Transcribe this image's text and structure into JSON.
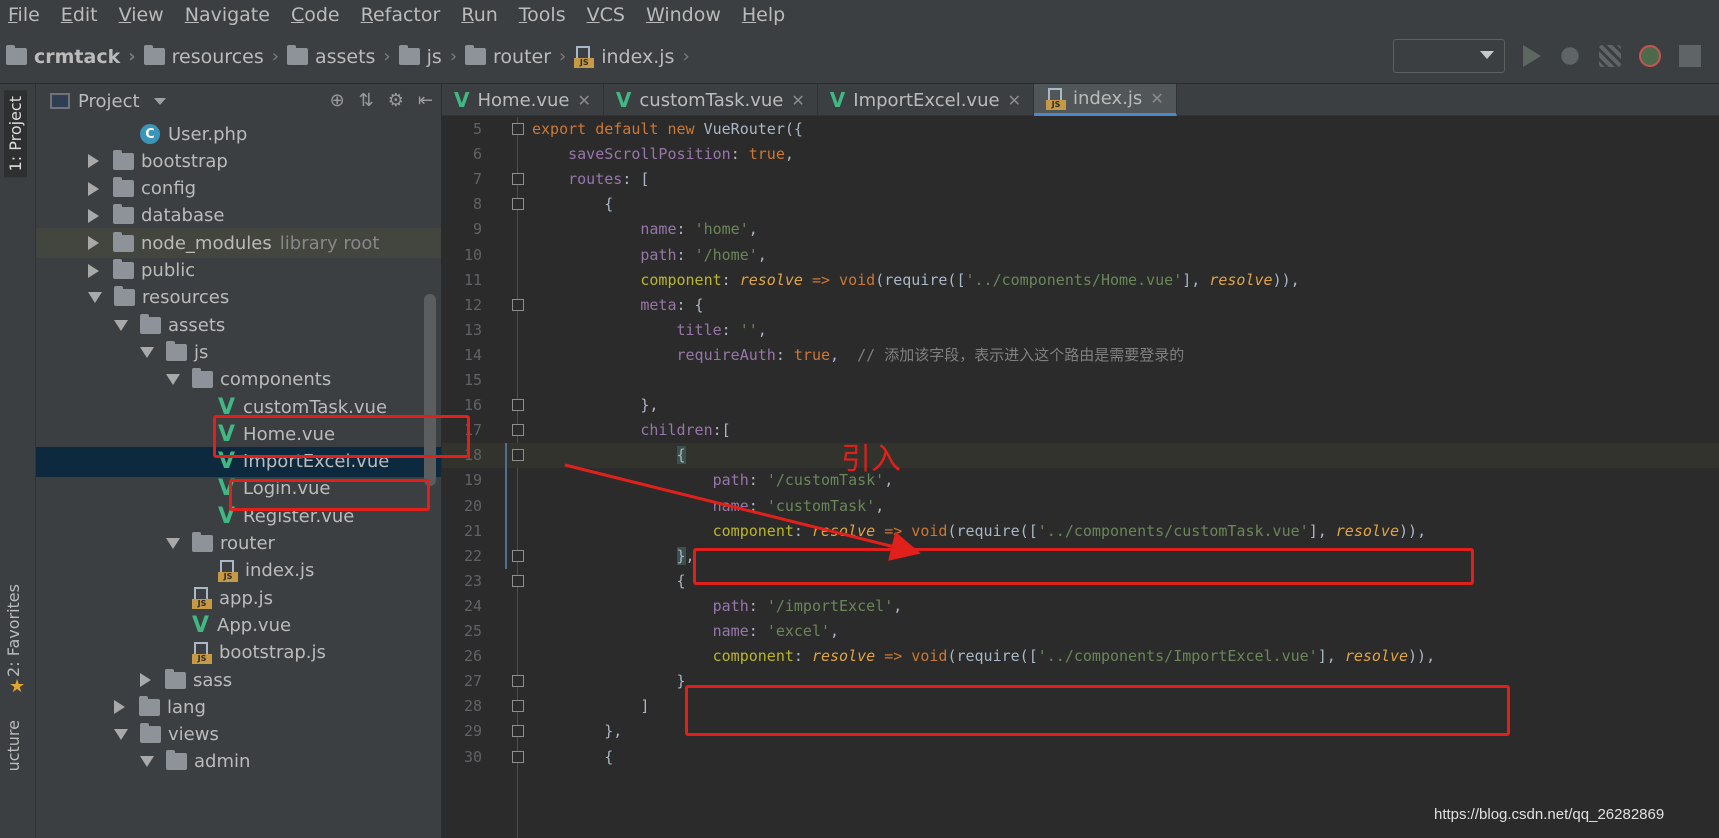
{
  "menu": [
    {
      "mnemonic": "F",
      "rest": "ile"
    },
    {
      "mnemonic": "E",
      "rest": "dit"
    },
    {
      "mnemonic": "V",
      "rest": "iew"
    },
    {
      "mnemonic": "N",
      "rest": "avigate"
    },
    {
      "mnemonic": "C",
      "rest": "ode"
    },
    {
      "mnemonic": "R",
      "rest": "efactor"
    },
    {
      "mnemonic": "R",
      "rest": "un"
    },
    {
      "mnemonic": "T",
      "rest": "ools"
    },
    {
      "mnemonic": "V",
      "rest": "CS"
    },
    {
      "mnemonic": "W",
      "rest": "indow"
    },
    {
      "mnemonic": "H",
      "rest": "elp"
    }
  ],
  "breadcrumb": [
    "crmtack",
    "resources",
    "assets",
    "js",
    "router",
    "index.js"
  ],
  "toolbar": {
    "run_config": "",
    "icons": [
      "run-icon",
      "debug-icon",
      "coverage-icon",
      "profile-icon",
      "stop-icon"
    ]
  },
  "strip": {
    "project": "1: Project",
    "favorites": "2: Favorites",
    "structure": "ucture"
  },
  "project_panel": {
    "title": "Project",
    "tools": [
      "⊕",
      "⇅",
      "⚙",
      "⇤"
    ],
    "tree": [
      {
        "label": "User.php",
        "type": "php",
        "depth": 4,
        "arrow": "none"
      },
      {
        "label": "bootstrap",
        "type": "folder",
        "depth": 2,
        "arrow": "closed"
      },
      {
        "label": "config",
        "type": "folder",
        "depth": 2,
        "arrow": "closed"
      },
      {
        "label": "database",
        "type": "folder",
        "depth": 2,
        "arrow": "closed"
      },
      {
        "label": "node_modules",
        "type": "folder",
        "depth": 2,
        "arrow": "closed",
        "extra": "library root"
      },
      {
        "label": "public",
        "type": "folder",
        "depth": 2,
        "arrow": "closed"
      },
      {
        "label": "resources",
        "type": "folder",
        "depth": 2,
        "arrow": "open"
      },
      {
        "label": "assets",
        "type": "folder",
        "depth": 3,
        "arrow": "open"
      },
      {
        "label": "js",
        "type": "folder",
        "depth": 4,
        "arrow": "open"
      },
      {
        "label": "components",
        "type": "folder",
        "depth": 5,
        "arrow": "open"
      },
      {
        "label": "customTask.vue",
        "type": "vue",
        "depth": 7,
        "arrow": "none"
      },
      {
        "label": "Home.vue",
        "type": "vue",
        "depth": 7,
        "arrow": "none"
      },
      {
        "label": "ImportExcel.vue",
        "type": "vue",
        "depth": 7,
        "arrow": "none",
        "selected": true
      },
      {
        "label": "Login.vue",
        "type": "vue",
        "depth": 7,
        "arrow": "none"
      },
      {
        "label": "Register.vue",
        "type": "vue",
        "depth": 7,
        "arrow": "none"
      },
      {
        "label": "router",
        "type": "folder",
        "depth": 5,
        "arrow": "open"
      },
      {
        "label": "index.js",
        "type": "js",
        "depth": 7,
        "arrow": "none"
      },
      {
        "label": "app.js",
        "type": "js",
        "depth": 6,
        "arrow": "none"
      },
      {
        "label": "App.vue",
        "type": "vue",
        "depth": 6,
        "arrow": "none"
      },
      {
        "label": "bootstrap.js",
        "type": "js",
        "depth": 6,
        "arrow": "none"
      },
      {
        "label": "sass",
        "type": "folder",
        "depth": 4,
        "arrow": "closed"
      },
      {
        "label": "lang",
        "type": "folder",
        "depth": 3,
        "arrow": "closed"
      },
      {
        "label": "views",
        "type": "folder",
        "depth": 3,
        "arrow": "open"
      },
      {
        "label": "admin",
        "type": "folder",
        "depth": 4,
        "arrow": "open"
      }
    ]
  },
  "tabs": [
    {
      "label": "Home.vue",
      "type": "vue"
    },
    {
      "label": "customTask.vue",
      "type": "vue"
    },
    {
      "label": "ImportExcel.vue",
      "type": "vue"
    },
    {
      "label": "index.js",
      "type": "js",
      "active": true
    }
  ],
  "code_lines": [
    {
      "n": "5",
      "fold": true,
      "tokens": [
        [
          "kw",
          "export default new "
        ],
        [
          "",
          "VueRouter({"
        ]
      ]
    },
    {
      "n": "6",
      "tokens": [
        [
          "",
          "    "
        ],
        [
          "prop",
          "saveScrollPosition"
        ],
        [
          "",
          ": "
        ],
        [
          "kw",
          "true"
        ],
        [
          "",
          ","
        ]
      ]
    },
    {
      "n": "7",
      "fold": true,
      "tokens": [
        [
          "",
          "    "
        ],
        [
          "prop",
          "routes"
        ],
        [
          "",
          ": ["
        ]
      ]
    },
    {
      "n": "8",
      "fold": true,
      "tokens": [
        [
          "",
          "        {"
        ]
      ]
    },
    {
      "n": "9",
      "tokens": [
        [
          "",
          "            "
        ],
        [
          "prop",
          "name"
        ],
        [
          "",
          ": "
        ],
        [
          "str",
          "'home'"
        ],
        [
          "",
          ","
        ]
      ]
    },
    {
      "n": "10",
      "tokens": [
        [
          "",
          "            "
        ],
        [
          "prop",
          "path"
        ],
        [
          "",
          ": "
        ],
        [
          "str",
          "'/home'"
        ],
        [
          "",
          ","
        ]
      ]
    },
    {
      "n": "11",
      "tokens": [
        [
          "",
          "            "
        ],
        [
          "key",
          "component"
        ],
        [
          "",
          ": "
        ],
        [
          "prm",
          "resolve"
        ],
        [
          "kw",
          " => void"
        ],
        [
          "",
          "(require(["
        ],
        [
          "str",
          "'../components/Home.vue'"
        ],
        [
          "",
          "], "
        ],
        [
          "prm",
          "resolve"
        ],
        [
          "",
          "))"
        ],
        [
          "",
          ","
        ]
      ]
    },
    {
      "n": "12",
      "fold": true,
      "tokens": [
        [
          "",
          "            "
        ],
        [
          "prop",
          "meta"
        ],
        [
          "",
          ": {"
        ]
      ]
    },
    {
      "n": "13",
      "tokens": [
        [
          "",
          "                "
        ],
        [
          "prop",
          "title"
        ],
        [
          "",
          ": "
        ],
        [
          "str",
          "''"
        ],
        [
          "",
          ","
        ]
      ]
    },
    {
      "n": "14",
      "tokens": [
        [
          "",
          "                "
        ],
        [
          "prop",
          "requireAuth"
        ],
        [
          "",
          ": "
        ],
        [
          "kw",
          "true"
        ],
        [
          "",
          ",  "
        ],
        [
          "cmt",
          "// 添加该字段，表示进入这个路由是需要登录的"
        ]
      ]
    },
    {
      "n": "15",
      "tokens": [
        [
          "",
          ""
        ]
      ]
    },
    {
      "n": "16",
      "fold": true,
      "tokens": [
        [
          "",
          "            },"
        ]
      ]
    },
    {
      "n": "17",
      "fold": true,
      "tokens": [
        [
          "",
          "            "
        ],
        [
          "prop",
          "children"
        ],
        [
          "",
          ":["
        ]
      ]
    },
    {
      "n": "18",
      "fold": true,
      "caret": true,
      "tokens": [
        [
          "",
          "                "
        ],
        [
          "brk-hl",
          "{"
        ]
      ]
    },
    {
      "n": "19",
      "tokens": [
        [
          "",
          "                    "
        ],
        [
          "prop",
          "path"
        ],
        [
          "",
          ": "
        ],
        [
          "str",
          "'/customTask'"
        ],
        [
          "",
          ","
        ]
      ]
    },
    {
      "n": "20",
      "tokens": [
        [
          "",
          "                    "
        ],
        [
          "prop",
          "name"
        ],
        [
          "",
          ": "
        ],
        [
          "str",
          "'customTask'"
        ],
        [
          "",
          ","
        ]
      ]
    },
    {
      "n": "21",
      "tokens": [
        [
          "",
          "                    "
        ],
        [
          "key",
          "component"
        ],
        [
          "",
          ": "
        ],
        [
          "prm",
          "resolve"
        ],
        [
          "kw",
          " => void"
        ],
        [
          "",
          "(require(["
        ],
        [
          "str",
          "'../components/customTask.vue'"
        ],
        [
          "",
          "], "
        ],
        [
          "prm",
          "resolve"
        ],
        [
          "",
          "))"
        ],
        [
          "",
          ","
        ]
      ]
    },
    {
      "n": "22",
      "fold": true,
      "tokens": [
        [
          "",
          "                "
        ],
        [
          "brk-hl",
          "}"
        ],
        [
          "",
          ","
        ]
      ]
    },
    {
      "n": "23",
      "fold": true,
      "tokens": [
        [
          "",
          "                {"
        ]
      ]
    },
    {
      "n": "24",
      "tokens": [
        [
          "",
          "                    "
        ],
        [
          "prop",
          "path"
        ],
        [
          "",
          ": "
        ],
        [
          "str",
          "'/importExcel'"
        ],
        [
          "",
          ","
        ]
      ]
    },
    {
      "n": "25",
      "tokens": [
        [
          "",
          "                    "
        ],
        [
          "prop",
          "name"
        ],
        [
          "",
          ": "
        ],
        [
          "str",
          "'excel'"
        ],
        [
          "",
          ","
        ]
      ]
    },
    {
      "n": "26",
      "tokens": [
        [
          "",
          "                    "
        ],
        [
          "key",
          "component"
        ],
        [
          "",
          ": "
        ],
        [
          "prm",
          "resolve"
        ],
        [
          "kw",
          " => void"
        ],
        [
          "",
          "(require(["
        ],
        [
          "str",
          "'../components/ImportExcel.vue'"
        ],
        [
          "",
          "], "
        ],
        [
          "prm",
          "resolve"
        ],
        [
          "",
          "))"
        ],
        [
          "",
          ","
        ]
      ]
    },
    {
      "n": "27",
      "fold": true,
      "tokens": [
        [
          "",
          "                }"
        ]
      ]
    },
    {
      "n": "28",
      "fold": true,
      "tokens": [
        [
          "",
          "            ]"
        ]
      ]
    },
    {
      "n": "29",
      "fold": true,
      "tokens": [
        [
          "",
          "        },"
        ]
      ]
    },
    {
      "n": "30",
      "fold": true,
      "tokens": [
        [
          "",
          "        {"
        ]
      ]
    }
  ],
  "annotation": {
    "label": "引入",
    "color": "#e1201c"
  },
  "watermark": "https://blog.csdn.net/qq_26282869"
}
